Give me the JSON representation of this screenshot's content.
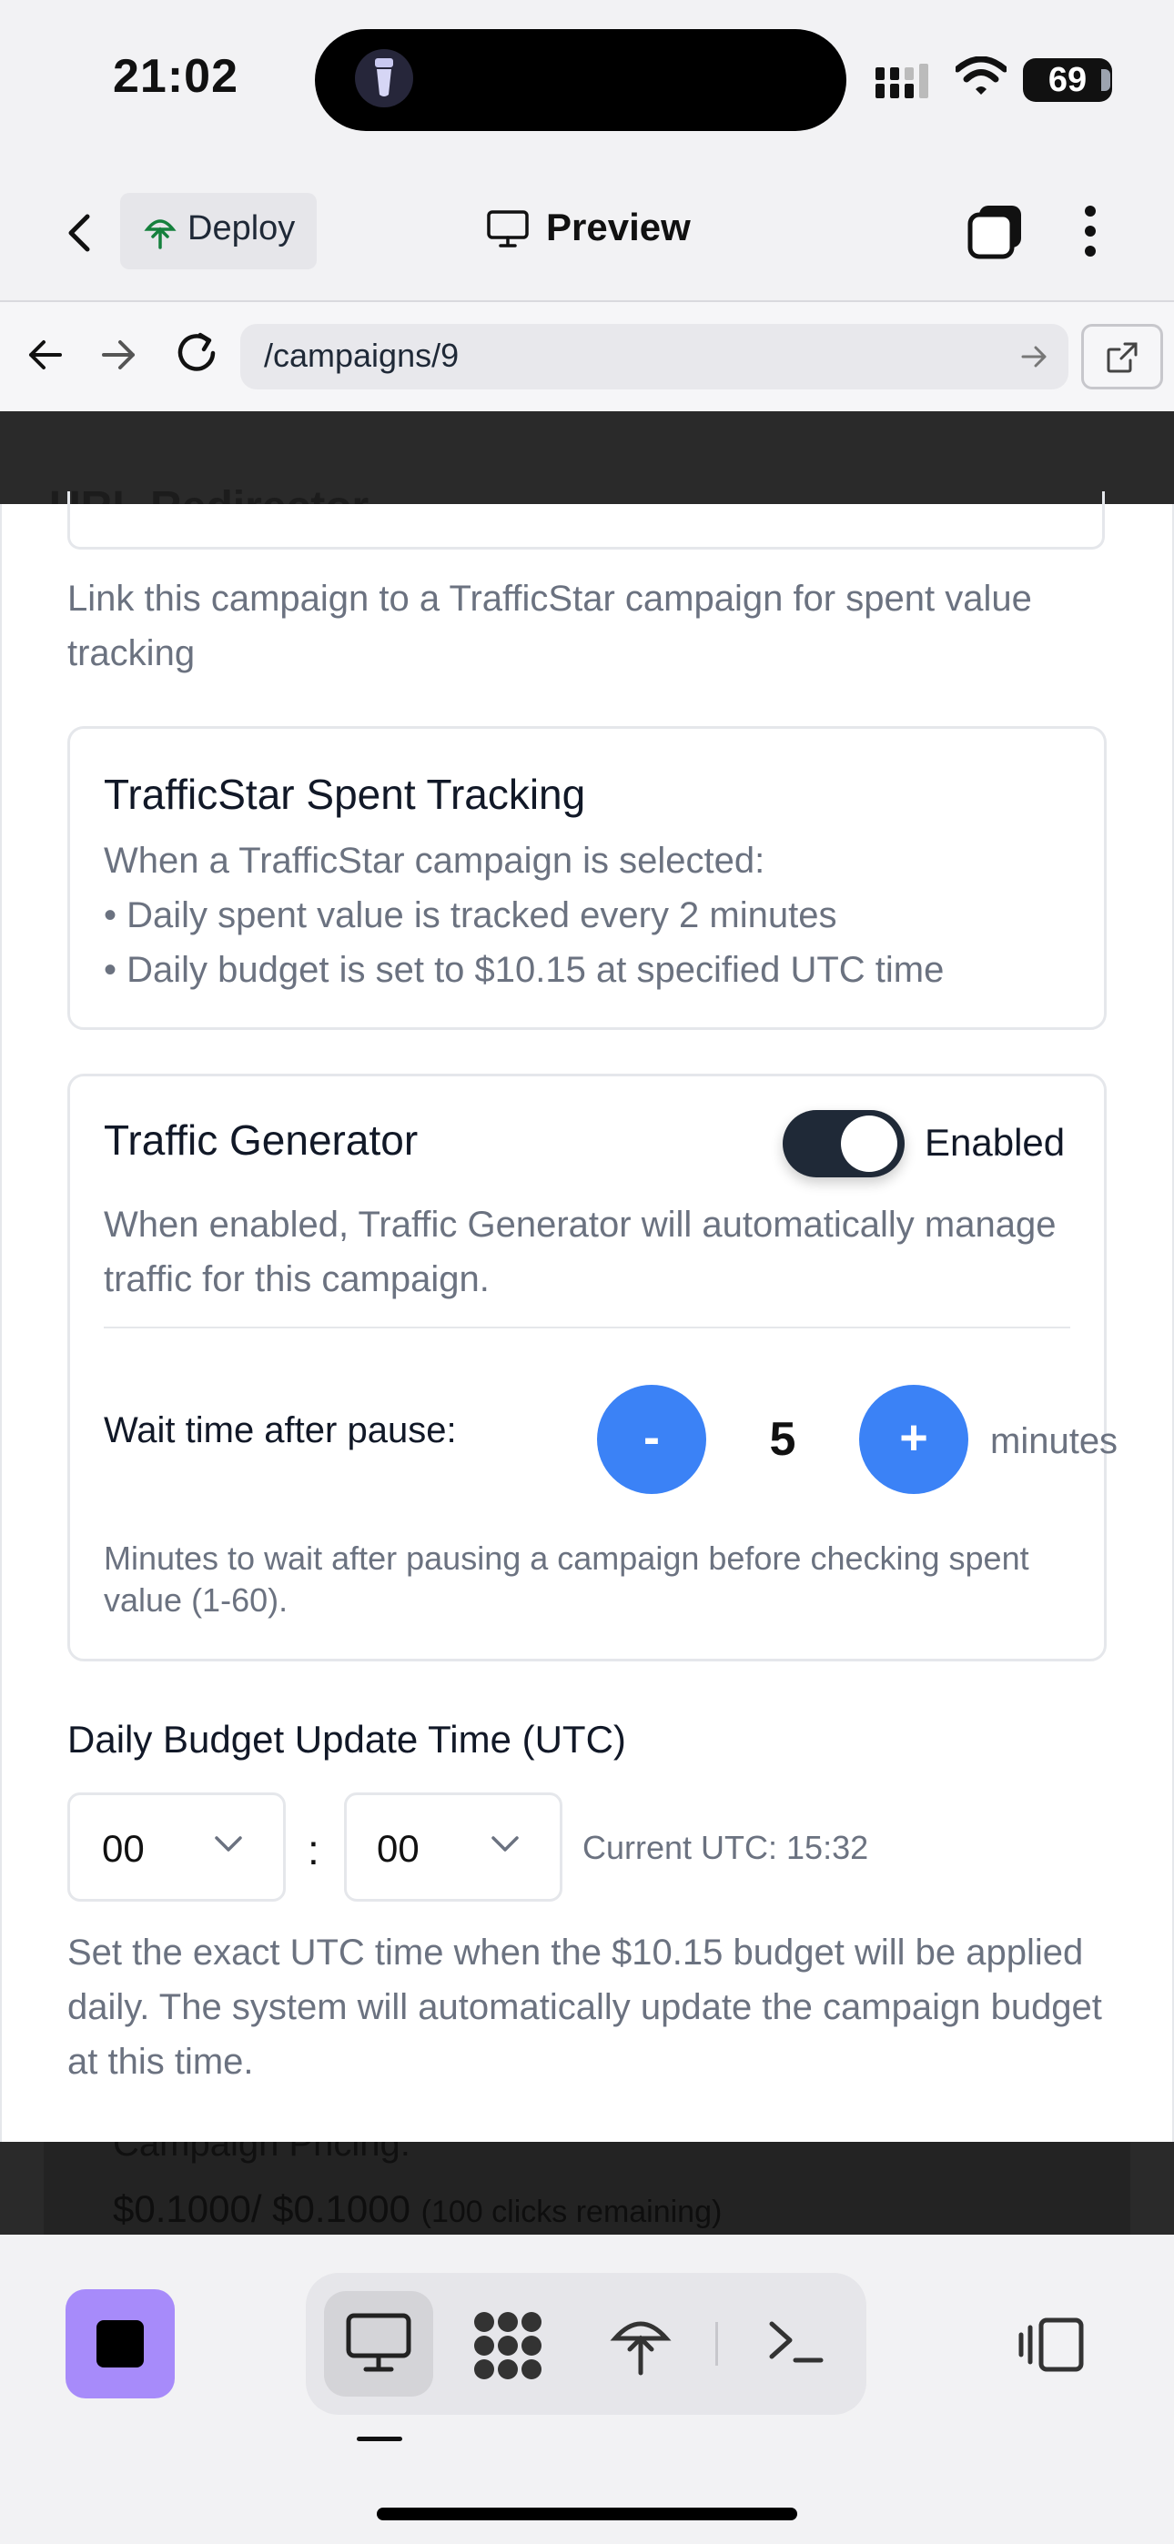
{
  "status_bar": {
    "time": "21:02",
    "battery": "69"
  },
  "app_header": {
    "deploy_label": "Deploy",
    "preview_label": "Preview"
  },
  "browser": {
    "url": "/campaigns/9"
  },
  "background": {
    "title": "URL Redirector",
    "pricing_label": "Campaign Pricing:",
    "pricing_value": "$0.1000/ $0.1000",
    "pricing_note": "(100 clicks remaining)"
  },
  "modal": {
    "link_help": "Link this campaign to a TrafficStar campaign for spent value tracking",
    "tracking_card": {
      "title": "TrafficStar Spent Tracking",
      "lines": [
        "When a TrafficStar campaign is selected:",
        "• Daily spent value is tracked every 2 minutes",
        "• Daily budget is set to $10.15 at specified UTC time"
      ]
    },
    "traffic_generator": {
      "title": "Traffic Generator",
      "toggle_label": "Enabled",
      "enabled": true,
      "description": "When enabled, Traffic Generator will automatically manage traffic for this campaign.",
      "wait_label": "Wait time after pause:",
      "minus_label": "-",
      "plus_label": "+",
      "wait_value": "5",
      "unit": "minutes",
      "wait_help": "Minutes to wait after pausing a campaign before checking spent value (1-60)."
    },
    "budget_time": {
      "label": "Daily Budget Update Time (UTC)",
      "hour": "00",
      "minute": "00",
      "separator": ":",
      "current_utc": "Current UTC: 15:32",
      "help": "Set the exact UTC time when the $10.15 budget will be applied daily. The system will automatically update the campaign budget at this time."
    }
  },
  "colors": {
    "accent": "#3b82f6",
    "toggle_on": "#1f2937",
    "stop_button": "#a78bfa"
  },
  "icons": [
    "chevron-left-icon",
    "deploy-icon",
    "monitor-icon",
    "tabs-icon",
    "more-vertical-icon",
    "arrow-left-icon",
    "arrow-right-icon",
    "reload-icon",
    "external-link-icon",
    "chevron-down-icon",
    "stop-icon",
    "apps-icon",
    "terminal-icon",
    "panel-icon"
  ]
}
